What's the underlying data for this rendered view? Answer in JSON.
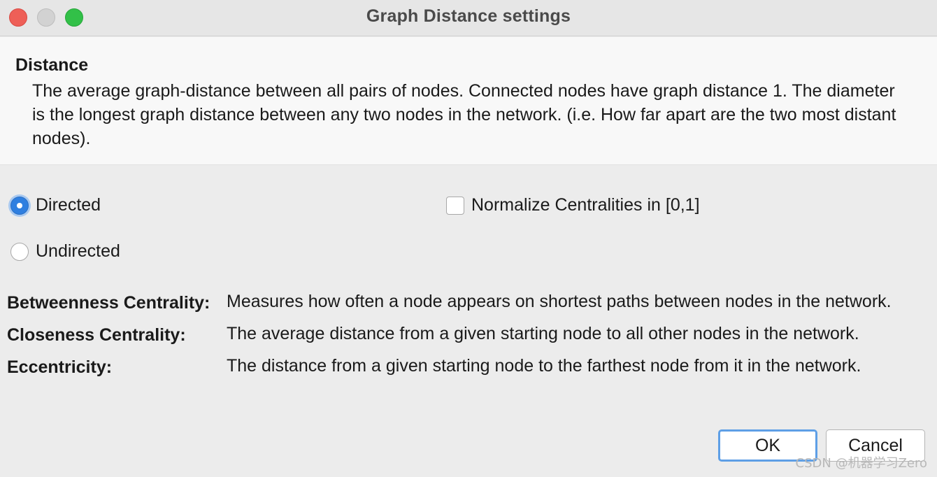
{
  "window": {
    "title": "Graph Distance settings"
  },
  "header": {
    "title": "Distance",
    "description": "The average graph-distance between all pairs of nodes. Connected nodes have graph distance 1. The diameter is the longest graph distance between any two nodes in the network. (i.e.  How far apart are the two most distant nodes)."
  },
  "options": {
    "directed_label": "Directed",
    "directed_checked": true,
    "undirected_label": "Undirected",
    "undirected_checked": false,
    "normalize_label": "Normalize Centralities in [0,1]",
    "normalize_checked": false
  },
  "definitions": [
    {
      "term": "Betweenness Centrality:",
      "text": "Measures how often a node appears on shortest paths between nodes in the network."
    },
    {
      "term": "Closeness Centrality:",
      "text": "The average distance from a given starting node to all other nodes in the network."
    },
    {
      "term": "Eccentricity:",
      "text": "The distance from a given starting node to the farthest node from it in the network."
    }
  ],
  "buttons": {
    "ok_label": "OK",
    "cancel_label": "Cancel"
  },
  "watermark": "CSDN @机器学习Zero",
  "colors": {
    "accent": "#2f7fe0",
    "close": "#ee5f57",
    "minimize": "#d2d2d2",
    "maximize": "#32c048"
  }
}
